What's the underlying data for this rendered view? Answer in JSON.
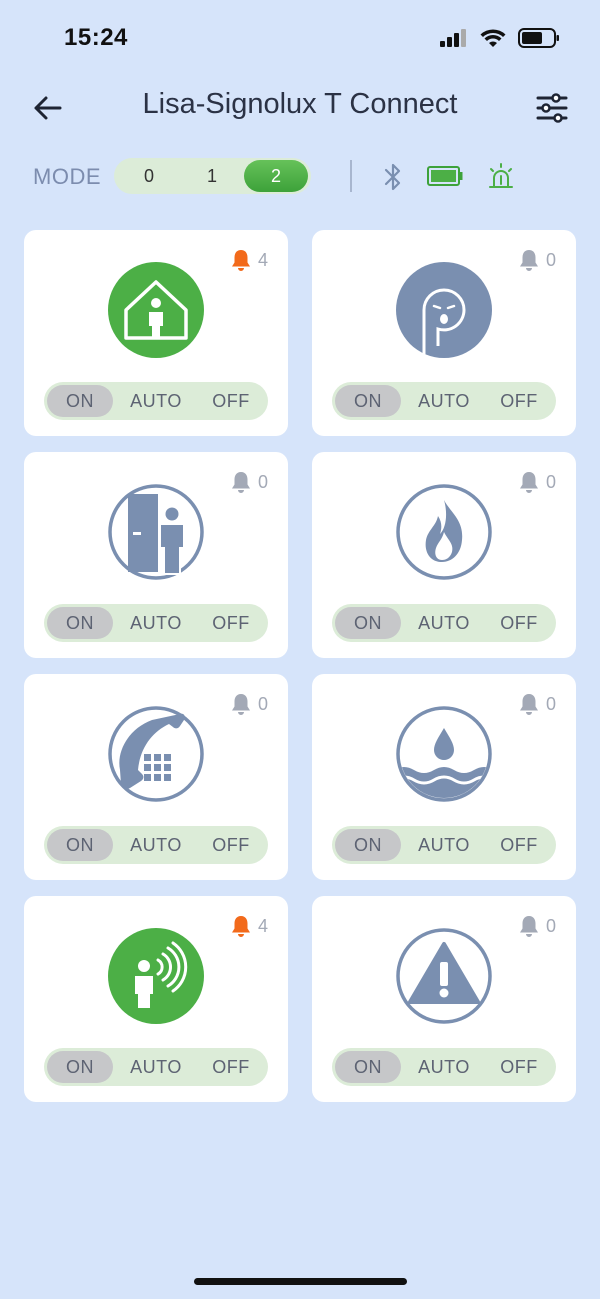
{
  "status_bar": {
    "time": "15:24"
  },
  "header": {
    "title": "Lisa-Signolux T Connect"
  },
  "mode": {
    "label": "MODE",
    "options": [
      "0",
      "1",
      "2"
    ],
    "selected": "2"
  },
  "colors": {
    "accent_green": "#4caf46",
    "icon_slate": "#7a8fb0",
    "alert_orange": "#f26a1b",
    "bell_gray": "#a3a9b6",
    "background": "#d6e4fa"
  },
  "tiles": [
    {
      "icon": "home-person-icon",
      "active": true,
      "alert": true,
      "count": "4",
      "state": {
        "on": "ON",
        "auto": "AUTO",
        "off": "OFF"
      }
    },
    {
      "icon": "baby-crying-icon",
      "active": false,
      "alert": false,
      "count": "0",
      "state": {
        "on": "ON",
        "auto": "AUTO",
        "off": "OFF"
      }
    },
    {
      "icon": "doorbell-person-icon",
      "active": false,
      "alert": false,
      "count": "0",
      "state": {
        "on": "ON",
        "auto": "AUTO",
        "off": "OFF"
      }
    },
    {
      "icon": "fire-icon",
      "active": false,
      "alert": false,
      "count": "0",
      "state": {
        "on": "ON",
        "auto": "AUTO",
        "off": "OFF"
      }
    },
    {
      "icon": "telephone-icon",
      "active": false,
      "alert": false,
      "count": "0",
      "state": {
        "on": "ON",
        "auto": "AUTO",
        "off": "OFF"
      }
    },
    {
      "icon": "water-drop-icon",
      "active": false,
      "alert": false,
      "count": "0",
      "state": {
        "on": "ON",
        "auto": "AUTO",
        "off": "OFF"
      }
    },
    {
      "icon": "voice-person-icon",
      "active": true,
      "alert": true,
      "count": "4",
      "state": {
        "on": "ON",
        "auto": "AUTO",
        "off": "OFF"
      }
    },
    {
      "icon": "warning-triangle-icon",
      "active": false,
      "alert": false,
      "count": "0",
      "state": {
        "on": "ON",
        "auto": "AUTO",
        "off": "OFF"
      }
    }
  ]
}
